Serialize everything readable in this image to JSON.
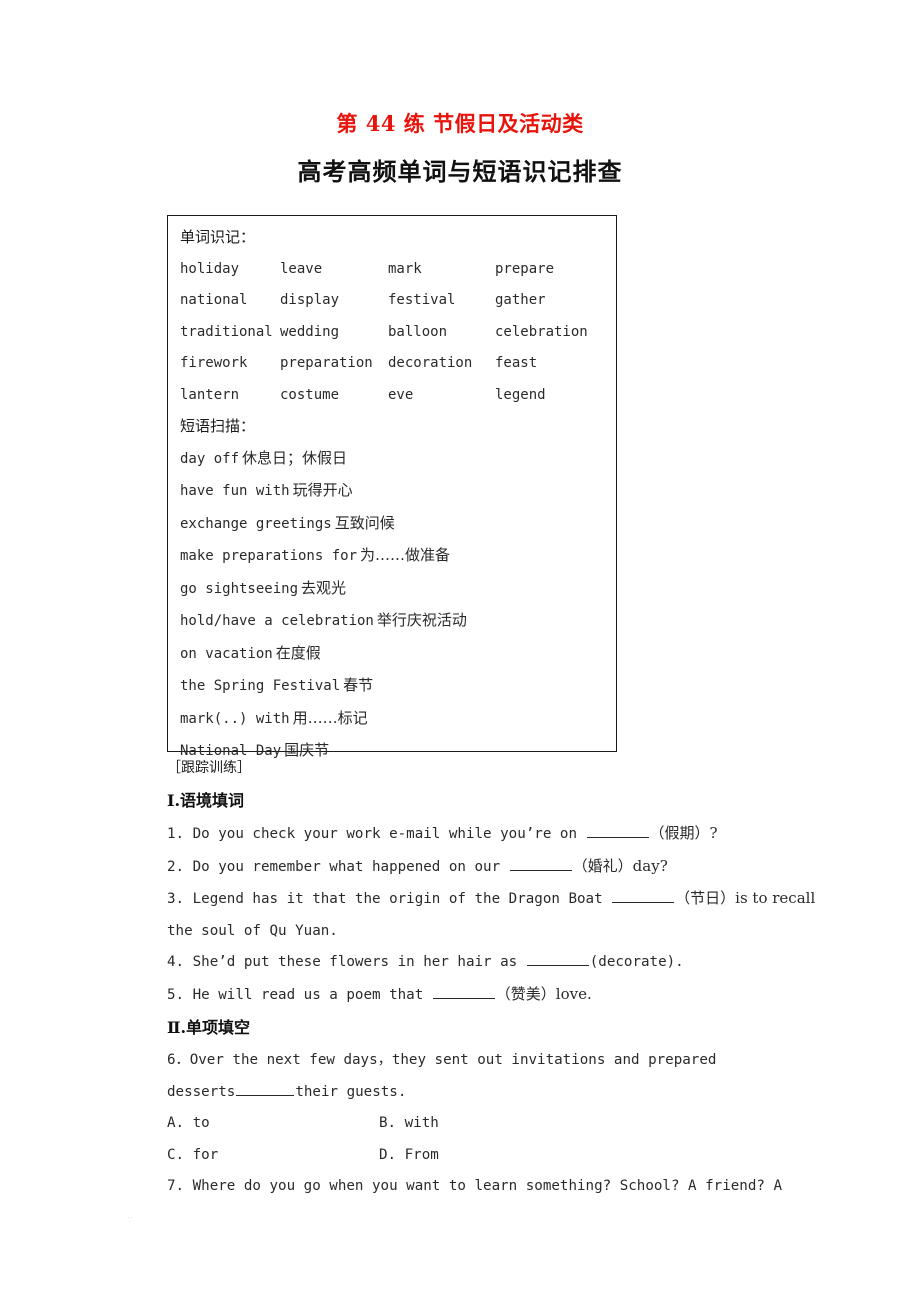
{
  "document": {
    "lesson_title": "第 44 练  节假日及活动类",
    "section_title": "高考高频单词与短语识记排查",
    "accent_color": "#e8140c"
  },
  "memo_box": {
    "words_label": "单词识记：",
    "word_rows": [
      [
        "holiday",
        "leave",
        "mark",
        "prepare"
      ],
      [
        "national",
        "display",
        "festival",
        "gather"
      ],
      [
        "traditional",
        "wedding",
        "balloon",
        "celebration"
      ],
      [
        "firework",
        "preparation",
        "decoration",
        "feast"
      ],
      [
        "lantern",
        "costume",
        "eve",
        "legend"
      ]
    ],
    "phrases_label": "短语扫描：",
    "phrases": [
      {
        "en": "day off",
        "cn": "休息日；休假日"
      },
      {
        "en": "have fun with",
        "cn": "玩得开心"
      },
      {
        "en": "exchange greetings",
        "cn": "互致问候"
      },
      {
        "en": "make preparations for",
        "cn": "为……做准备"
      },
      {
        "en": "go sightseeing",
        "cn": "去观光"
      },
      {
        "en": "hold/have a celebration",
        "cn": "举行庆祝活动"
      },
      {
        "en": "on vacation",
        "cn": "在度假"
      },
      {
        "en": "the Spring Festival",
        "cn": "春节"
      },
      {
        "en": "mark(..) with",
        "cn": "用……标记"
      },
      {
        "en": "National Day",
        "cn": "国庆节"
      }
    ]
  },
  "exercises": {
    "bracket_note": "［跟踪训练］",
    "part1_head": "Ⅰ.语境填词",
    "part2_head": "Ⅱ.单项填空",
    "q1_a": "1. Do you check your work e-mail while you’re on ",
    "q1_cn": "（假期）?",
    "q2_a": "2. Do you remember what happened on our ",
    "q2_cn": "（婚礼）day?",
    "q3_a": "3. Legend has it that the origin of the Dragon Boat ",
    "q3_cn": "（节日）is to recall",
    "q3_b": "the soul of Qu Yuan.",
    "q4_a": "4. She’d put these flowers in her hair as ",
    "q4_cn": "(decorate).",
    "q5_a": "5. He will read us a poem that ",
    "q5_cn": "（赞美）love.",
    "q6_a": "6．Over the next few days，they sent out invitations and prepared",
    "q6_b1": "desserts",
    "q6_b2": "their guests.",
    "q6_options": [
      {
        "label": "A. to"
      },
      {
        "label": "B. with"
      },
      {
        "label": "C. for"
      },
      {
        "label": "D. From"
      }
    ],
    "q7": "7. Where do you go when you want to learn something? School? A friend? A"
  }
}
